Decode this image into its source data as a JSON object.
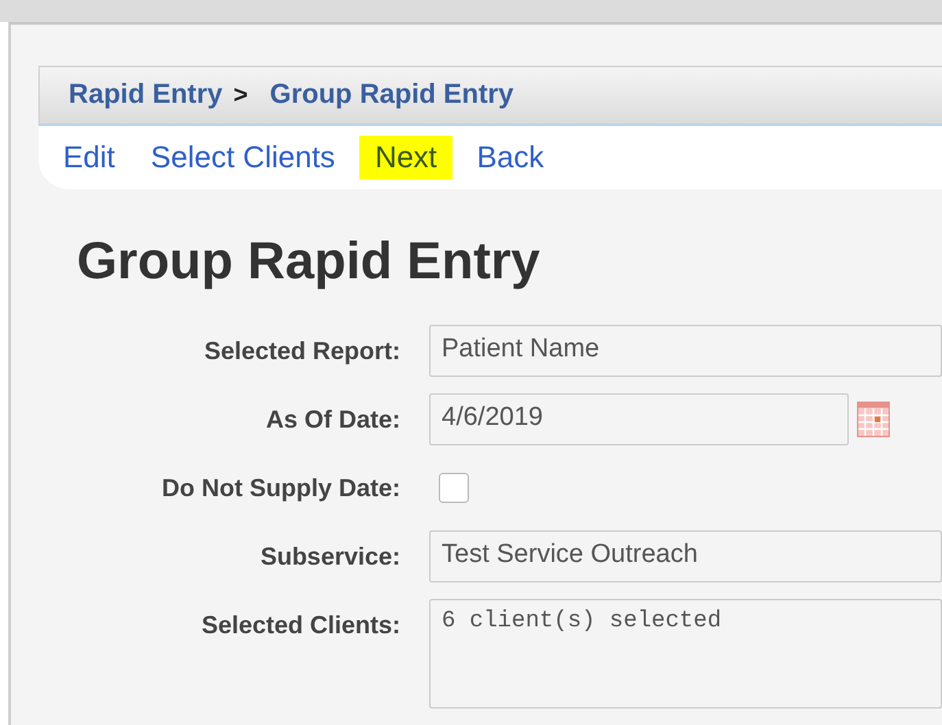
{
  "breadcrumb": {
    "parent": "Rapid Entry",
    "separator": ">",
    "current": "Group Rapid Entry"
  },
  "menu": [
    {
      "label": "Edit",
      "selected": false
    },
    {
      "label": "Select Clients",
      "selected": false
    },
    {
      "label": "Next",
      "selected": true
    },
    {
      "label": "Back",
      "selected": false
    }
  ],
  "heading": "Group Rapid Entry",
  "form": [
    {
      "kind": "text",
      "label": "Selected Report:",
      "value": "Patient Name"
    },
    {
      "kind": "date",
      "label": "As Of Date:",
      "value": "4/6/2019"
    },
    {
      "kind": "checkbox",
      "label": "Do Not Supply Date:",
      "checked": false
    },
    {
      "kind": "text",
      "label": "Subservice:",
      "value": "Test Service Outreach"
    },
    {
      "kind": "textarea",
      "label": "Selected Clients:",
      "value": "6 client(s) selected"
    }
  ]
}
